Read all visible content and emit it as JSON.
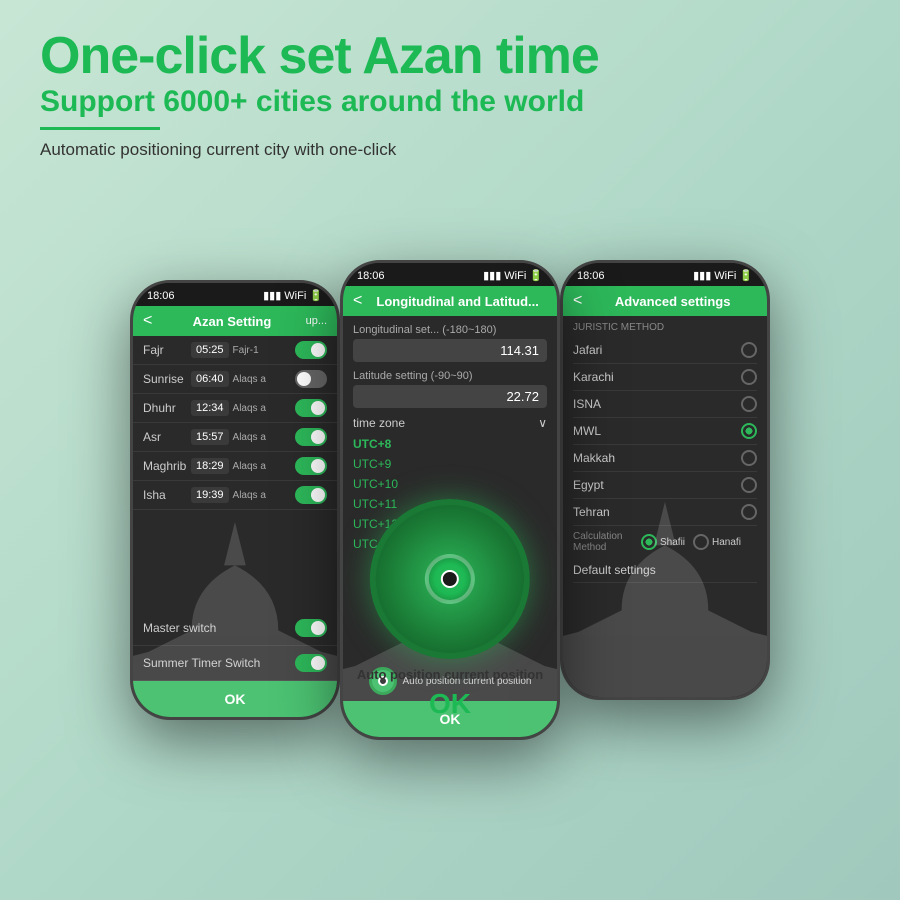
{
  "header": {
    "main_title": "One-click set Azan time",
    "sub_title": "Support 6000+ cities around the world",
    "divider": true,
    "description": "Automatic positioning  current city with one-click"
  },
  "phone_left": {
    "status_bar": {
      "time": "18:06"
    },
    "nav": {
      "back": "<",
      "title": "Azan Setting",
      "right": "up..."
    },
    "prayers": [
      {
        "name": "Fajr",
        "time": "05:25",
        "label": "Fajr-1",
        "toggle": "on"
      },
      {
        "name": "Sunrise",
        "time": "06:40",
        "label": "Alaqs a",
        "toggle": "off"
      },
      {
        "name": "Dhuhr",
        "time": "12:34",
        "label": "Alaqs a",
        "toggle": "on"
      },
      {
        "name": "Asr",
        "time": "15:57",
        "label": "Alaqs a",
        "toggle": "on"
      },
      {
        "name": "Maghrib",
        "time": "18:29",
        "label": "Alaqs a",
        "toggle": "on"
      },
      {
        "name": "Isha",
        "time": "19:39",
        "label": "Alaqs a",
        "toggle": "on"
      }
    ],
    "master_switch": {
      "label": "Master switch",
      "toggle": "on"
    },
    "summer_switch": {
      "label": "Summer Timer Switch",
      "toggle": "on"
    },
    "ok_button": "OK"
  },
  "phone_middle": {
    "status_bar": {
      "time": "18:06"
    },
    "nav": {
      "back": "<",
      "title": "Longitudinal and Latitud..."
    },
    "longitudinal_label": "Longitudinal set... (-180~180)",
    "longitudinal_value": "114.31",
    "latitude_label": "Latitude setting (-90~90)",
    "latitude_value": "22.72",
    "timezone_label": "time zone",
    "timezones": [
      "UTC+8",
      "UTC+9",
      "UTC+10",
      "UTC+11",
      "UTC+12",
      "UTC+11"
    ],
    "auto_position": "Auto position current position",
    "ok_button": "OK"
  },
  "phone_right": {
    "status_bar": {
      "time": "18:06"
    },
    "nav": {
      "back": "<",
      "title": "Advanced settings"
    },
    "juristic_label": "Juristic Method",
    "methods": [
      {
        "name": "Jafari",
        "selected": false
      },
      {
        "name": "Karachi",
        "selected": false
      },
      {
        "name": "ISNA",
        "selected": false
      },
      {
        "name": "MWL",
        "selected": true
      },
      {
        "name": "Makkah",
        "selected": false
      },
      {
        "name": "Egypt",
        "selected": false
      },
      {
        "name": "Tehran",
        "selected": false
      }
    ],
    "calculation_method_label": "Calculation Method",
    "shafii": "Shafii",
    "hanafi": "Hanafi",
    "default_settings": "Default settings"
  },
  "big_circle": {
    "auto_position": "Auto position current position",
    "ok": "OK"
  }
}
